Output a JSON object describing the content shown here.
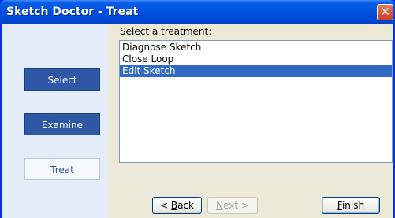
{
  "window": {
    "title": "Sketch Doctor - Treat",
    "close_glyph": "✕"
  },
  "sidebar": {
    "items": [
      {
        "label": "Select",
        "state": "inactive"
      },
      {
        "label": "Examine",
        "state": "inactive"
      },
      {
        "label": "Treat",
        "state": "active"
      }
    ]
  },
  "main": {
    "prompt": "Select a treatment:",
    "treatments": [
      {
        "label": "Diagnose Sketch",
        "selected": false
      },
      {
        "label": "Close Loop",
        "selected": false
      },
      {
        "label": "Edit Sketch",
        "selected": true
      }
    ]
  },
  "buttons": {
    "back": {
      "mnemonic": "B",
      "rest": "ack",
      "prefix": "< "
    },
    "next": {
      "mnemonic": "N",
      "rest": "ext >"
    },
    "finish": {
      "mnemonic": "F",
      "rest": "inish"
    }
  },
  "colors": {
    "title_bar": "#0050e0",
    "selection": "#316ac5",
    "sidebar_active_btn": "#2e58a6",
    "sidebar_bg": "#e4ecf7"
  }
}
